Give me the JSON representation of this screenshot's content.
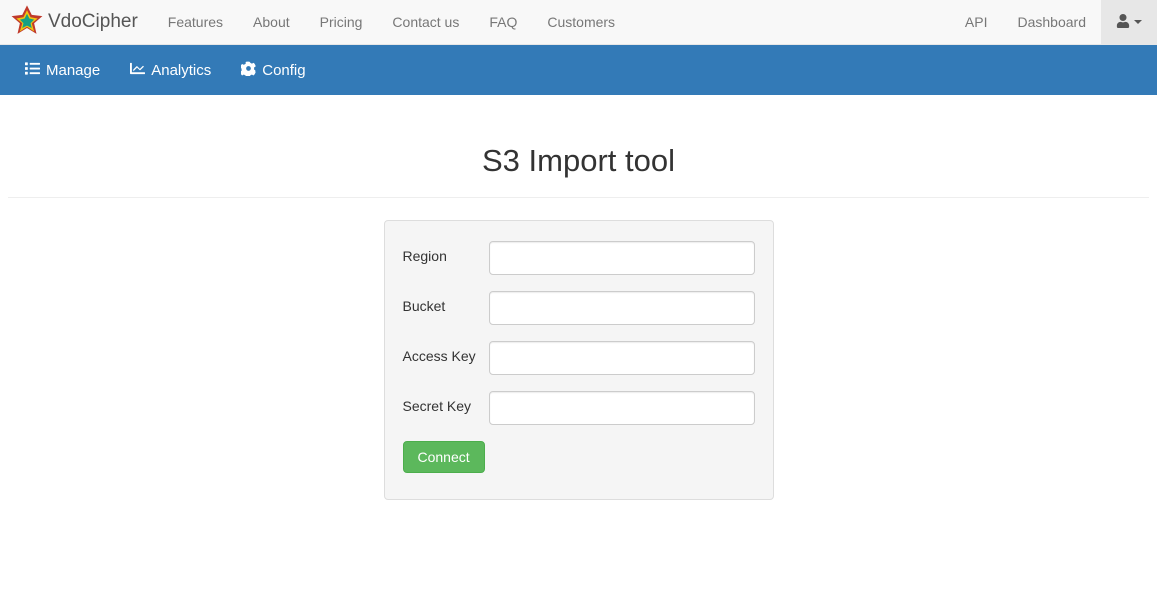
{
  "brand": "VdoCipher",
  "topnav": {
    "items": [
      {
        "label": "Features"
      },
      {
        "label": "About"
      },
      {
        "label": "Pricing"
      },
      {
        "label": "Contact us"
      },
      {
        "label": "FAQ"
      },
      {
        "label": "Customers"
      }
    ],
    "right": [
      {
        "label": "API"
      },
      {
        "label": "Dashboard"
      }
    ]
  },
  "subnav": {
    "items": [
      {
        "label": "Manage"
      },
      {
        "label": "Analytics"
      },
      {
        "label": "Config"
      }
    ]
  },
  "page": {
    "title": "S3 Import tool"
  },
  "form": {
    "region": {
      "label": "Region",
      "value": ""
    },
    "bucket": {
      "label": "Bucket",
      "value": ""
    },
    "accesskey": {
      "label": "Access Key",
      "value": ""
    },
    "secretkey": {
      "label": "Secret Key",
      "value": ""
    },
    "connect": "Connect"
  }
}
